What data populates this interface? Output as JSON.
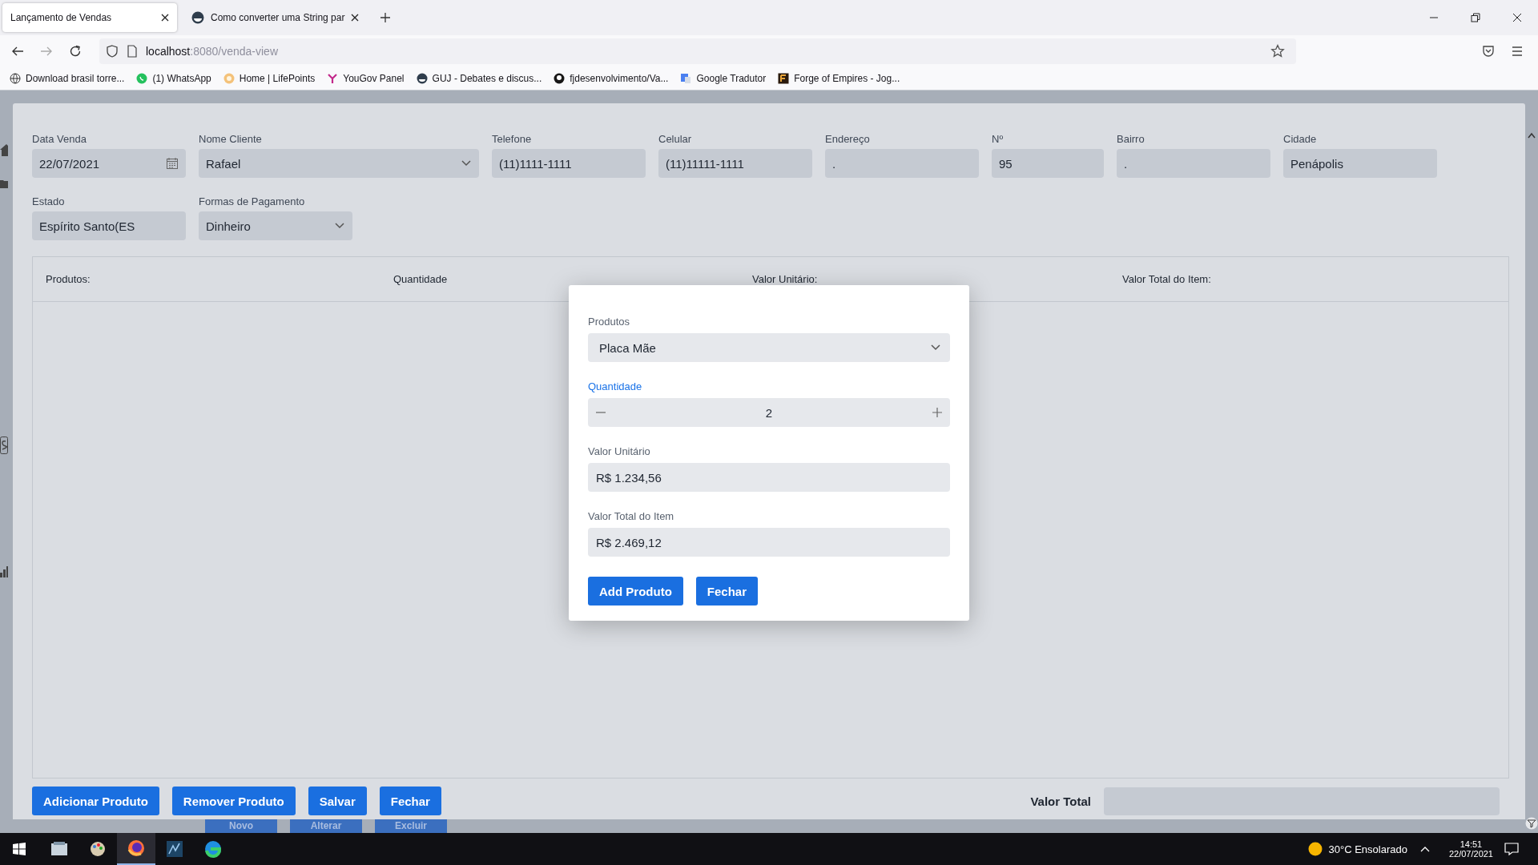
{
  "browser": {
    "tabs": [
      {
        "title": "Lançamento de Vendas",
        "selected": true,
        "kind": "plain"
      },
      {
        "title": "Como converter uma String par",
        "selected": false,
        "kind": "site"
      }
    ],
    "address": {
      "host": "localhost",
      "path": ":8080/venda-view"
    },
    "bookmarks": [
      {
        "kind": "globe",
        "label": "Download brasil torre..."
      },
      {
        "kind": "chat",
        "label": "(1) WhatsApp"
      },
      {
        "kind": "sun",
        "label": "Home | LifePoints"
      },
      {
        "kind": "fork",
        "label": "YouGov Panel"
      },
      {
        "kind": "dot",
        "label": "GUJ - Debates e discus..."
      },
      {
        "kind": "cat",
        "label": "fjdesenvolvimento/Va..."
      },
      {
        "kind": "translate",
        "label": "Google Tradutor"
      },
      {
        "kind": "square",
        "label": "Forge of Empires - Jog..."
      }
    ]
  },
  "form": {
    "rows": [
      [
        {
          "kind": "date",
          "label": "Data Venda",
          "value": "22/07/2021"
        },
        {
          "kind": "select",
          "label": "Nome Cliente",
          "value": "Rafael"
        },
        {
          "kind": "text",
          "label": "Telefone",
          "value": "(11)1111-1111"
        },
        {
          "kind": "text",
          "label": "Celular",
          "value": "(11)11111-1111"
        },
        {
          "kind": "text",
          "label": "Endereço",
          "value": "."
        },
        {
          "kind": "text",
          "label": "Nº",
          "value": "95"
        },
        {
          "kind": "text",
          "label": "Bairro",
          "value": "."
        },
        {
          "kind": "text",
          "label": "Cidade",
          "value": "Penápolis"
        }
      ],
      [
        {
          "kind": "text",
          "label": "Estado",
          "value": "Espírito Santo(ES"
        },
        {
          "kind": "select",
          "label": "Formas de Pagamento",
          "value": "Dinheiro"
        }
      ]
    ]
  },
  "table": {
    "columns": [
      "Produtos:",
      "Quantidade",
      "Valor Unitário:",
      "Valor Total do Item:"
    ]
  },
  "actions": [
    "Adicionar Produto",
    "Remover Produto",
    "Salvar",
    "Fechar"
  ],
  "total": {
    "label": "Valor Total"
  },
  "background_buttons": [
    "Novo",
    "Alterar",
    "Excluir"
  ],
  "modal": {
    "fields": [
      {
        "kind": "select",
        "label": "Produtos",
        "value": "Placa Mãe",
        "focused": false
      },
      {
        "kind": "stepper",
        "label": "Quantidade",
        "value": "2",
        "focused": true
      },
      {
        "kind": "text",
        "label": "Valor Unitário",
        "value": "R$ 1.234,56",
        "focused": false
      },
      {
        "kind": "text",
        "label": "Valor Total do Item",
        "value": "R$ 2.469,12",
        "focused": false
      }
    ],
    "buttons": [
      "Add Produto",
      "Fechar"
    ]
  },
  "taskbar": {
    "apps": [
      {
        "kind": "folder",
        "selected": false
      },
      {
        "kind": "paint",
        "selected": false
      },
      {
        "kind": "fox",
        "selected": true
      },
      {
        "kind": "db",
        "selected": false
      },
      {
        "kind": "edge",
        "selected": false
      }
    ],
    "weather": "30°C Ensolarado",
    "time": "14:51",
    "date": "22/07/2021"
  }
}
